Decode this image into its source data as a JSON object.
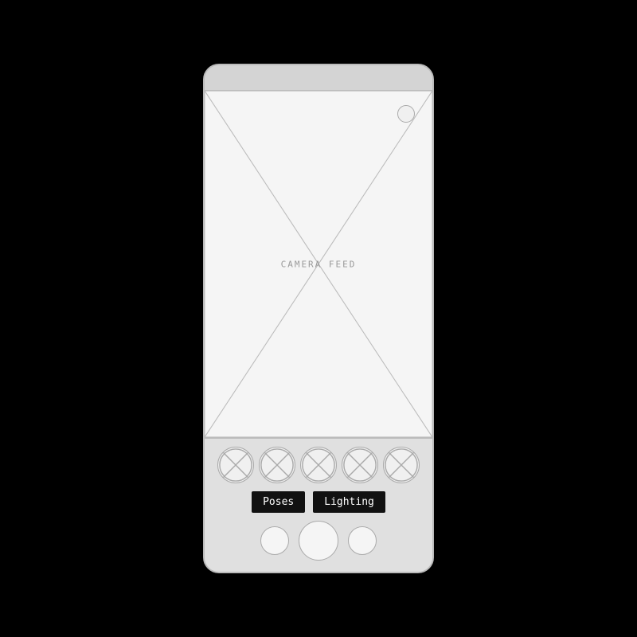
{
  "device": {
    "camera_feed_label": "CAMERA FEED"
  },
  "buttons": {
    "poses_label": "Poses",
    "lighting_label": "Lighting"
  },
  "thumbnails": {
    "count": 5
  },
  "controls": {
    "small_left_label": "",
    "large_center_label": "",
    "small_right_label": ""
  }
}
